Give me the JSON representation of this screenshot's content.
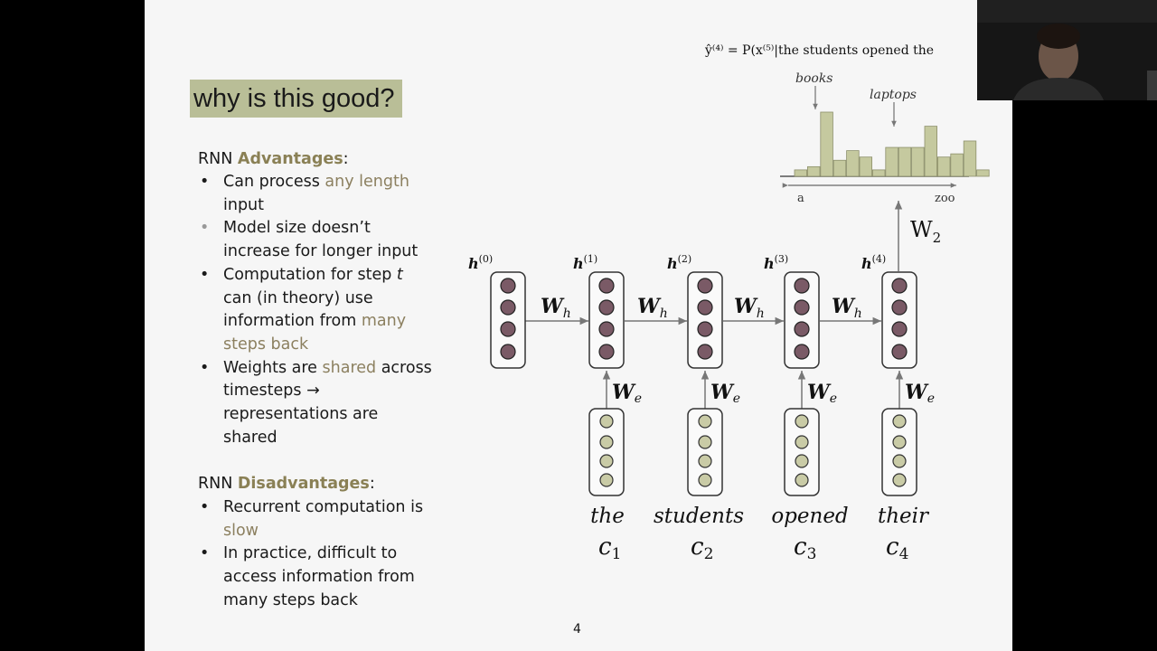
{
  "slide": {
    "title": "why is this good?",
    "formula": "ŷ⁽⁴⁾ = P(x⁽⁵⁾|the students opened the",
    "page_number": "4"
  },
  "advantages": {
    "heading_prefix": "RNN ",
    "heading_bold": "Advantages",
    "heading_suffix": ":",
    "points": [
      {
        "a": "Can process ",
        "hl": "any length",
        "b": " input"
      },
      {
        "hl": "Model size doesn’t increase",
        "b": " for longer input"
      },
      {
        "a": "Computation for step ",
        "it": "t",
        "b": " can (in theory) use information from ",
        "hl": "many steps back"
      },
      {
        "a": "Weights are ",
        "hl": "shared",
        "b": " across timesteps → representations are shared"
      }
    ]
  },
  "disadvantages": {
    "heading_prefix": "RNN ",
    "heading_bold": "Disadvantages",
    "heading_suffix": ":",
    "points": [
      {
        "a": "Recurrent computation is ",
        "hl": "slow"
      },
      {
        "a": "In practice, difficult to access information from many steps back"
      }
    ]
  },
  "diagram": {
    "hidden_labels": [
      "h(0)",
      "h(1)",
      "h(2)",
      "h(3)",
      "h(4)"
    ],
    "hidden_weight_label": "W_h",
    "embed_weight_label": "W_e",
    "output_weight_label": "W_2",
    "words": [
      "the",
      "students",
      "opened",
      "their"
    ],
    "word_vectors": [
      "c1",
      "c2",
      "c3",
      "c4"
    ],
    "histogram": {
      "label_left": "a",
      "label_right": "zoo",
      "annotations": [
        "books",
        "laptops"
      ],
      "bar_heights": [
        0.1,
        0.15,
        1.0,
        0.25,
        0.4,
        0.3,
        0.1,
        0.45,
        0.45,
        0.45,
        0.78,
        0.3,
        0.35,
        0.55,
        0.1
      ]
    }
  },
  "colors": {
    "slide_bg": "#f6f6f6",
    "title_bg": "#b9be97",
    "accent": "#8c8060",
    "hidden_node": "#7a5a66",
    "input_node": "#c9cba6",
    "hist_bar": "#c5c99f"
  }
}
